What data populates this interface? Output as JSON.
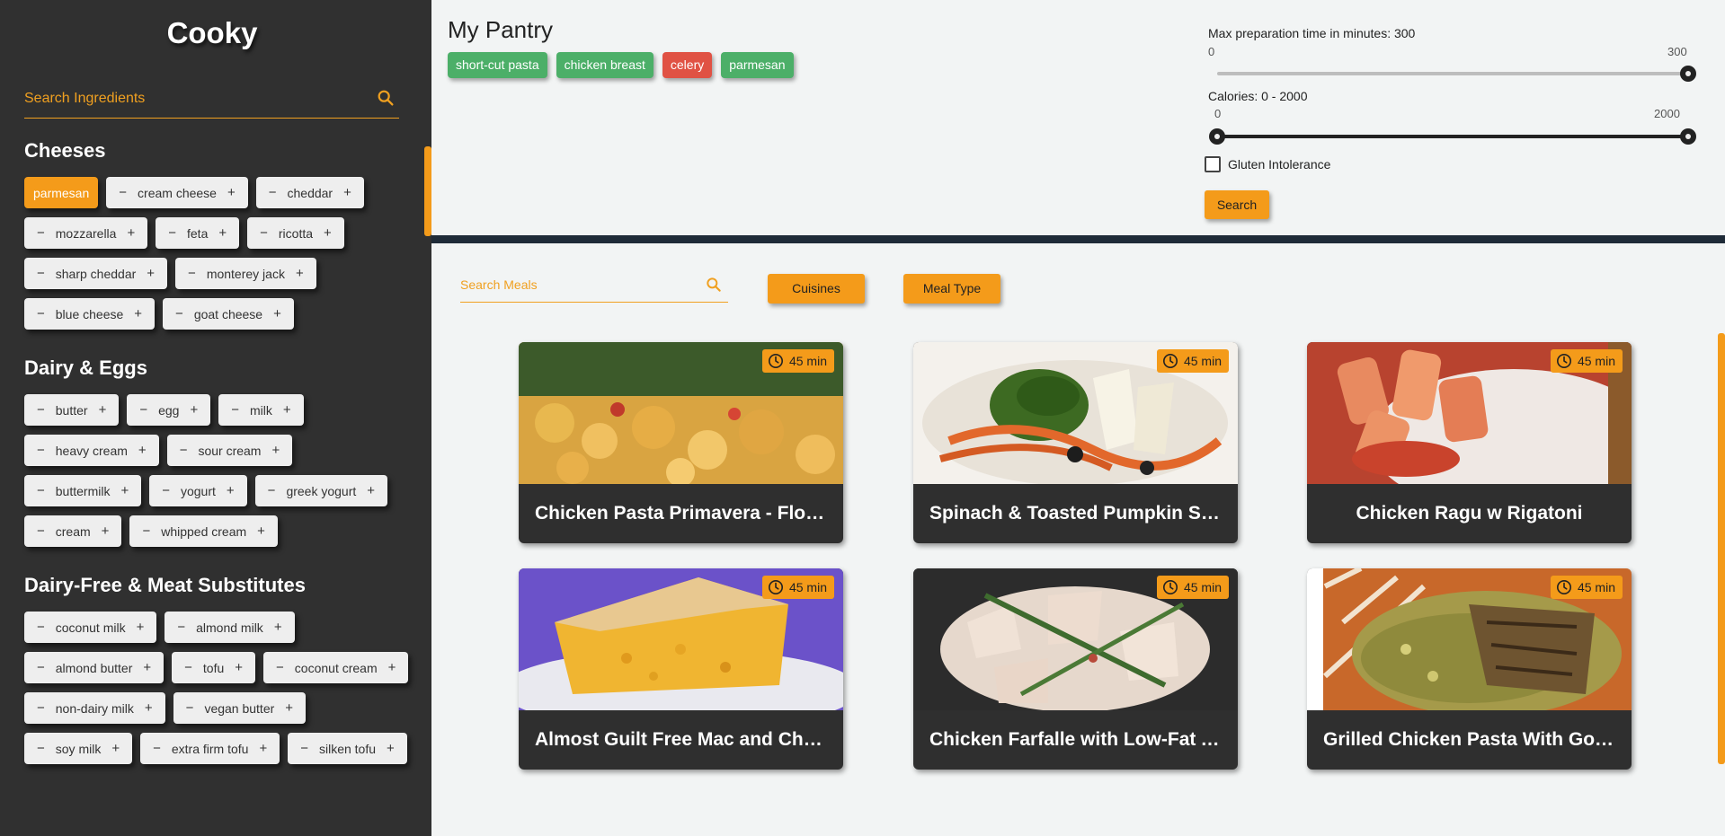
{
  "sidebar": {
    "brand": "Cooky",
    "search_placeholder": "Search Ingredients",
    "categories": [
      {
        "title": "Cheeses",
        "items": [
          {
            "label": "parmesan",
            "selected": true
          },
          {
            "label": "cream cheese"
          },
          {
            "label": "cheddar"
          },
          {
            "label": "mozzarella"
          },
          {
            "label": "feta"
          },
          {
            "label": "ricotta"
          },
          {
            "label": "sharp cheddar"
          },
          {
            "label": "monterey jack"
          },
          {
            "label": "blue cheese"
          },
          {
            "label": "goat cheese"
          }
        ]
      },
      {
        "title": "Dairy & Eggs",
        "items": [
          {
            "label": "butter"
          },
          {
            "label": "egg"
          },
          {
            "label": "milk"
          },
          {
            "label": "heavy cream"
          },
          {
            "label": "sour cream"
          },
          {
            "label": "buttermilk"
          },
          {
            "label": "yogurt"
          },
          {
            "label": "greek yogurt"
          },
          {
            "label": "cream"
          },
          {
            "label": "whipped cream"
          }
        ]
      },
      {
        "title": "Dairy-Free & Meat Substitutes",
        "items": [
          {
            "label": "coconut milk"
          },
          {
            "label": "almond milk"
          },
          {
            "label": "almond butter"
          },
          {
            "label": "tofu"
          },
          {
            "label": "coconut cream"
          },
          {
            "label": "non-dairy milk"
          },
          {
            "label": "vegan butter"
          },
          {
            "label": "soy milk"
          },
          {
            "label": "extra firm tofu"
          },
          {
            "label": "silken tofu"
          }
        ]
      }
    ],
    "minus_symbol": "−",
    "plus_symbol": "+"
  },
  "pantry": {
    "title": "My Pantry",
    "tags": [
      {
        "label": "short-cut pasta",
        "color": "#4caf68"
      },
      {
        "label": "chicken breast",
        "color": "#4caf68"
      },
      {
        "label": "celery",
        "color": "#e05244"
      },
      {
        "label": "parmesan",
        "color": "#4caf68"
      }
    ]
  },
  "filters": {
    "max_prep_label": "Max preparation time in minutes: 300",
    "max_prep_min": "0",
    "max_prep_max": "300",
    "max_prep_value": 300,
    "calories_label": "Calories: 0 - 2000",
    "calories_min": "0",
    "calories_max": "2000",
    "calories_range": [
      0,
      2000
    ],
    "gluten_label": "Gluten Intolerance",
    "gluten_checked": false,
    "search_button": "Search"
  },
  "meals": {
    "search_placeholder": "Search Meals",
    "cuisines_button": "Cuisines",
    "meal_type_button": "Meal Type",
    "cards": [
      {
        "title": "Chicken Pasta Primavera - Flow…",
        "time": "45 min"
      },
      {
        "title": "Spinach & Toasted Pumpkin Se…",
        "time": "45 min"
      },
      {
        "title": "Chicken Ragu w Rigatoni",
        "time": "45 min"
      },
      {
        "title": "Almost Guilt Free Mac and Che…",
        "time": "45 min"
      },
      {
        "title": "Chicken Farfalle with Low-Fat A…",
        "time": "45 min"
      },
      {
        "title": "Grilled Chicken Pasta With Gorg…",
        "time": "45 min"
      }
    ]
  },
  "colors": {
    "accent": "#f49b1a",
    "sidebar_bg": "#303030",
    "panel_bg": "#f2f4f4",
    "tag_green": "#4caf68",
    "tag_red": "#e05244"
  }
}
